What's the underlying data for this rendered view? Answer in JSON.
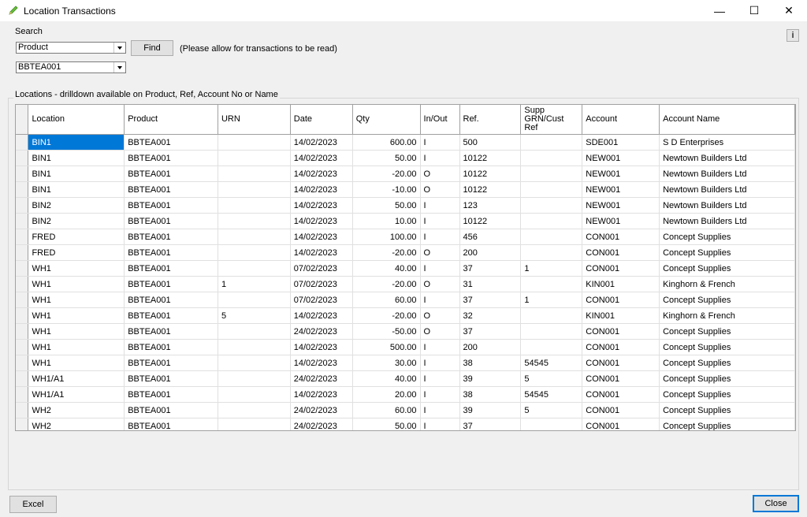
{
  "window": {
    "title": "Location Transactions",
    "minimize": "—",
    "maximize": "☐",
    "close": "✕",
    "info": "i"
  },
  "search": {
    "label": "Search",
    "field_value": "Product",
    "value": "BBTEA001",
    "find_label": "Find",
    "hint": "(Please allow for transactions to be read)"
  },
  "group": {
    "legend": "Locations - drilldown available on Product, Ref, Account No or Name"
  },
  "grid": {
    "headers": [
      "Location",
      "Product",
      "URN",
      "Date",
      "Qty",
      "In/Out",
      "Ref.",
      "Supp GRN/Cust Ref",
      "Account",
      "Account Name"
    ],
    "rows": [
      [
        "BIN1",
        "BBTEA001",
        "",
        "14/02/2023",
        "600.00",
        "I",
        "500",
        "",
        "SDE001",
        "S D Enterprises"
      ],
      [
        "BIN1",
        "BBTEA001",
        "",
        "14/02/2023",
        "50.00",
        "I",
        "10122",
        "",
        "NEW001",
        "Newtown Builders Ltd"
      ],
      [
        "BIN1",
        "BBTEA001",
        "",
        "14/02/2023",
        "-20.00",
        "O",
        "10122",
        "",
        "NEW001",
        "Newtown Builders Ltd"
      ],
      [
        "BIN1",
        "BBTEA001",
        "",
        "14/02/2023",
        "-10.00",
        "O",
        "10122",
        "",
        "NEW001",
        "Newtown Builders Ltd"
      ],
      [
        "BIN2",
        "BBTEA001",
        "",
        "14/02/2023",
        "50.00",
        "I",
        "123",
        "",
        "NEW001",
        "Newtown Builders Ltd"
      ],
      [
        "BIN2",
        "BBTEA001",
        "",
        "14/02/2023",
        "10.00",
        "I",
        "10122",
        "",
        "NEW001",
        "Newtown Builders Ltd"
      ],
      [
        "FRED",
        "BBTEA001",
        "",
        "14/02/2023",
        "100.00",
        "I",
        "456",
        "",
        "CON001",
        "Concept Supplies"
      ],
      [
        "FRED",
        "BBTEA001",
        "",
        "14/02/2023",
        "-20.00",
        "O",
        "200",
        "",
        "CON001",
        "Concept Supplies"
      ],
      [
        "WH1",
        "BBTEA001",
        "",
        "07/02/2023",
        "40.00",
        "I",
        "37",
        "1",
        "CON001",
        "Concept Supplies"
      ],
      [
        "WH1",
        "BBTEA001",
        "1",
        "07/02/2023",
        "-20.00",
        "O",
        "31",
        "",
        "KIN001",
        "Kinghorn & French"
      ],
      [
        "WH1",
        "BBTEA001",
        "",
        "07/02/2023",
        "60.00",
        "I",
        "37",
        "1",
        "CON001",
        "Concept Supplies"
      ],
      [
        "WH1",
        "BBTEA001",
        "5",
        "14/02/2023",
        "-20.00",
        "O",
        "32",
        "",
        "KIN001",
        "Kinghorn & French"
      ],
      [
        "WH1",
        "BBTEA001",
        "",
        "24/02/2023",
        "-50.00",
        "O",
        "37",
        "",
        "CON001",
        "Concept Supplies"
      ],
      [
        "WH1",
        "BBTEA001",
        "",
        "14/02/2023",
        "500.00",
        "I",
        "200",
        "",
        "CON001",
        "Concept Supplies"
      ],
      [
        "WH1",
        "BBTEA001",
        "",
        "14/02/2023",
        "30.00",
        "I",
        "38",
        "54545",
        "CON001",
        "Concept Supplies"
      ],
      [
        "WH1/A1",
        "BBTEA001",
        "",
        "24/02/2023",
        "40.00",
        "I",
        "39",
        "5",
        "CON001",
        "Concept Supplies"
      ],
      [
        "WH1/A1",
        "BBTEA001",
        "",
        "14/02/2023",
        "20.00",
        "I",
        "38",
        "54545",
        "CON001",
        "Concept Supplies"
      ],
      [
        "WH2",
        "BBTEA001",
        "",
        "24/02/2023",
        "60.00",
        "I",
        "39",
        "5",
        "CON001",
        "Concept Supplies"
      ],
      [
        "WH2",
        "BBTEA001",
        "",
        "24/02/2023",
        "50.00",
        "I",
        "37",
        "",
        "CON001",
        "Concept Supplies"
      ]
    ]
  },
  "footer": {
    "excel_label": "Excel",
    "close_label": "Close"
  },
  "colors": {
    "selection": "#0078d7",
    "window_bg": "#f0f0f0"
  }
}
